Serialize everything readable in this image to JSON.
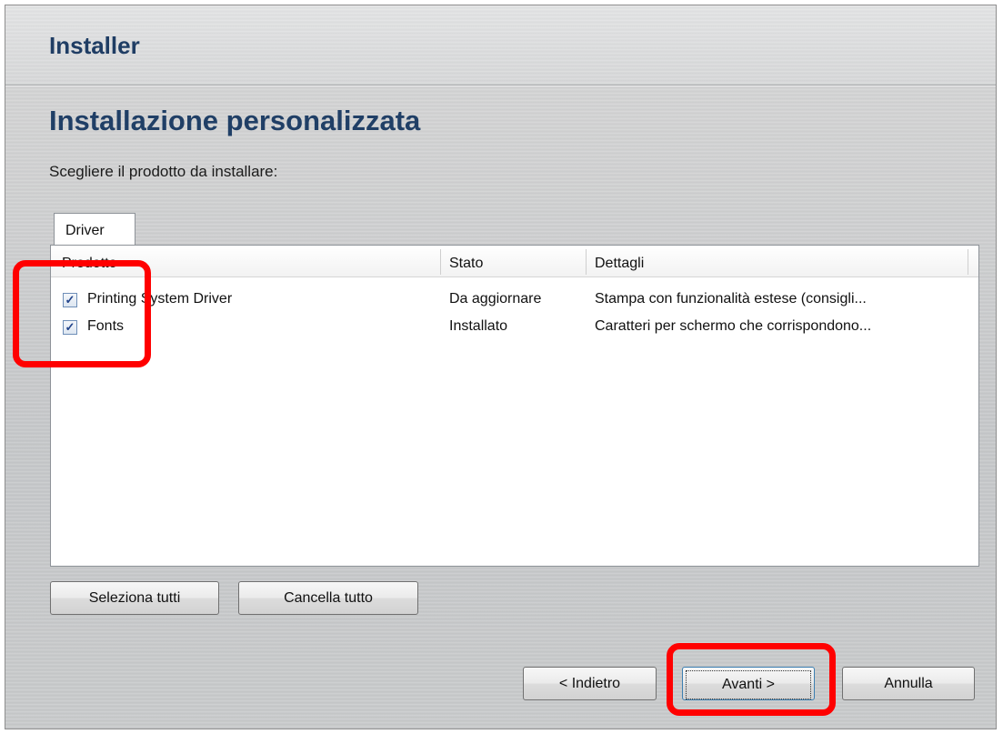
{
  "window": {
    "title": "Installer"
  },
  "page": {
    "heading": "Installazione personalizzata",
    "prompt": "Scegliere il prodotto da installare:"
  },
  "tabs": [
    {
      "label": "Driver",
      "selected": true
    }
  ],
  "table": {
    "columns": [
      "Prodotto",
      "Stato",
      "Dettagli"
    ],
    "rows": [
      {
        "checked": true,
        "product": "Printing System Driver",
        "status": "Da aggiornare",
        "details": "Stampa con funzionalità estese (consigli..."
      },
      {
        "checked": true,
        "product": "Fonts",
        "status": "Installato",
        "details": "Caratteri per schermo che corrispondono..."
      }
    ]
  },
  "selection_buttons": {
    "select_all": "Seleziona tutti",
    "clear_all": "Cancella tutto"
  },
  "nav_buttons": {
    "back": "< Indietro",
    "next": "Avanti >",
    "cancel": "Annulla"
  },
  "annotations": {
    "highlight_color": "#ff0000"
  },
  "colors": {
    "title": "#1f3d64",
    "heading": "#203f66",
    "checkbox_mark": "#21438a"
  },
  "icons": {
    "checkbox_checked": "check-mark"
  }
}
